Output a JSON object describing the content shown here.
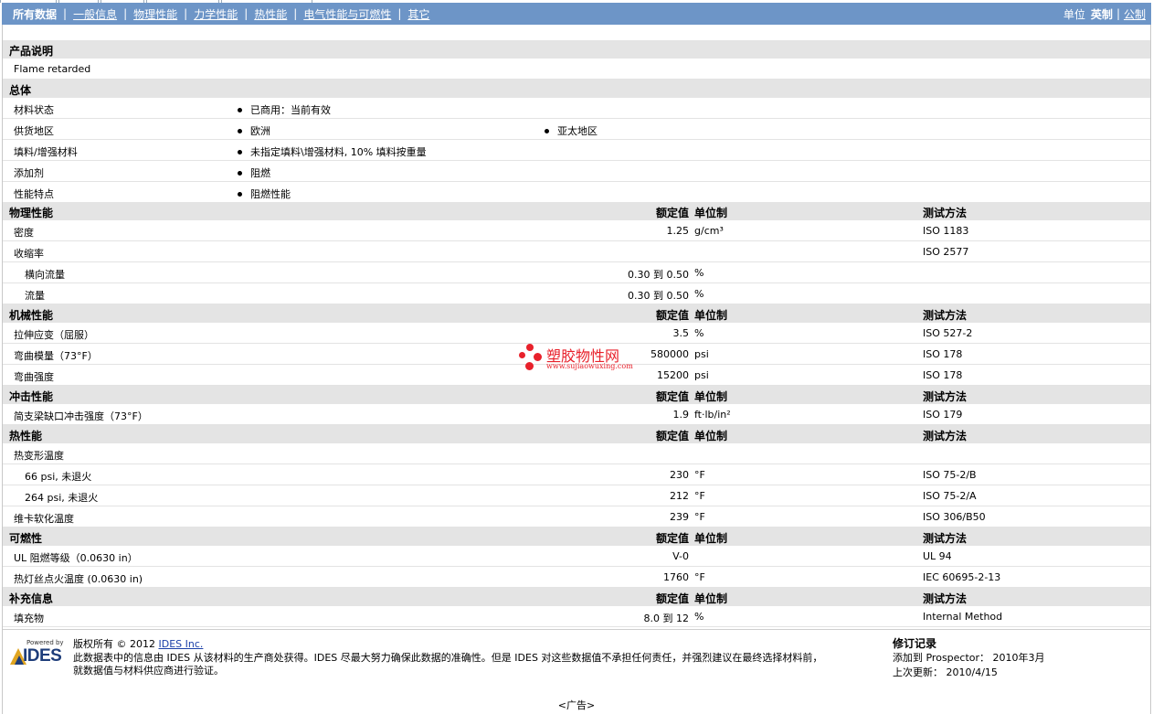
{
  "nav": {
    "tabs": [
      {
        "label": "所有数据",
        "active": true
      },
      {
        "label": "一般信息"
      },
      {
        "label": "物理性能"
      },
      {
        "label": "力学性能"
      },
      {
        "label": "热性能"
      },
      {
        "label": "电气性能与可燃性"
      },
      {
        "label": "其它"
      }
    ],
    "units_label": "单位",
    "unit_current": "英制",
    "unit_other": "公制"
  },
  "col_headers": {
    "value": "额定值",
    "unit": "单位制",
    "test": "测试方法"
  },
  "description": {
    "title": "产品说明",
    "text": "Flame retarded"
  },
  "general": {
    "title": "总体",
    "status_label": "材料状态",
    "status_value": "已商用：当前有效",
    "region_label": "供货地区",
    "region_1": "欧洲",
    "region_2": "亚太地区",
    "filler_label": "填料/增强材料",
    "filler_value": "未指定填料\\增强材料, 10% 填料按重量",
    "additive_label": "添加剂",
    "additive_value": "阻燃",
    "feature_label": "性能特点",
    "feature_value": "阻燃性能"
  },
  "physical": {
    "title": "物理性能",
    "rows": [
      {
        "label": "密度",
        "value": "1.25",
        "unit": "g/cm³",
        "test": "ISO 1183"
      },
      {
        "label": "收缩率",
        "value": "",
        "unit": "",
        "test": "ISO 2577"
      },
      {
        "label": "横向流量",
        "value": "0.30 到  0.50",
        "unit": "%",
        "test": ""
      },
      {
        "label": "流量",
        "value": "0.30 到  0.50",
        "unit": "%",
        "test": ""
      }
    ]
  },
  "mechanical": {
    "title": "机械性能",
    "rows": [
      {
        "label": "拉伸应变（屈服）",
        "value": "3.5",
        "unit": "%",
        "test": "ISO 527-2"
      },
      {
        "label": "弯曲模量（73°F）",
        "value": "580000",
        "unit": "psi",
        "test": "ISO 178"
      },
      {
        "label": "弯曲强度",
        "value": "15200",
        "unit": "psi",
        "test": "ISO 178"
      }
    ]
  },
  "impact": {
    "title": "冲击性能",
    "rows": [
      {
        "label": "简支梁缺口冲击强度（73°F）",
        "value": "1.9",
        "unit": "ft·lb/in²",
        "test": "ISO 179"
      }
    ]
  },
  "thermal": {
    "title": "热性能",
    "rows": [
      {
        "label": "热变形温度",
        "value": "",
        "unit": "",
        "test": ""
      },
      {
        "label": "66 psi, 未退火",
        "value": "230",
        "unit": "°F",
        "test": "ISO 75-2/B"
      },
      {
        "label": "264 psi, 未退火",
        "value": "212",
        "unit": "°F",
        "test": "ISO 75-2/A"
      },
      {
        "label": "维卡软化温度",
        "value": "239",
        "unit": "°F",
        "test": "ISO 306/B50"
      }
    ]
  },
  "flammability": {
    "title": "可燃性",
    "rows": [
      {
        "label": "UL 阻燃等级（0.0630 in）",
        "value": "V-0",
        "unit": "",
        "test": "UL 94"
      },
      {
        "label": "热灯丝点火温度 (0.0630 in)",
        "value": "1760",
        "unit": "°F",
        "test": "IEC 60695-2-13"
      }
    ]
  },
  "supplemental": {
    "title": "补充信息",
    "rows": [
      {
        "label": "填充物",
        "value": "8.0 到  12",
        "unit": "%",
        "test": "Internal Method"
      }
    ]
  },
  "watermark": {
    "name": "塑胶物性网",
    "url": "www.sujiaowuxing.com"
  },
  "footer": {
    "logo_powered": "Powered by",
    "logo_name": "IDES",
    "copyright_prefix": "版权所有  © 2012",
    "copyright_link": "IDES Inc.",
    "disclaimer_1": "此数据表中的信息由  IDES 从该材料的生产商处获得。IDES 尽最大努力确保此数据的准确性。但是  IDES 对这些数据值不承担任何责任，并强烈建议在最终选择材料前，",
    "disclaimer_2": "就数据值与材料供应商进行验证。",
    "rev_title": "修订记录",
    "rev_added": "添加到  Prospector：  2010年3月",
    "rev_updated": "上次更新：   2010/4/15"
  },
  "ad": "<广告>"
}
